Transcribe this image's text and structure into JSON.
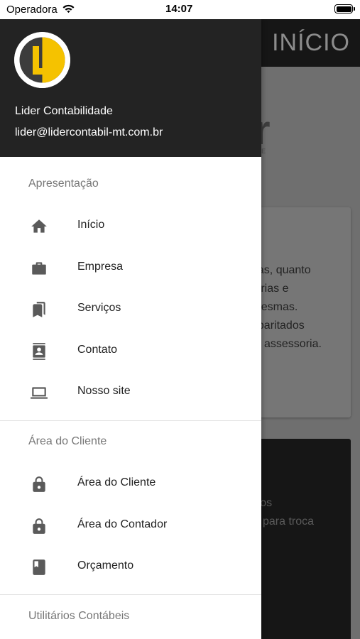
{
  "status_bar": {
    "carrier": "Operadora",
    "time": "14:07"
  },
  "background_screen": {
    "title": "INÍCIO",
    "logo_fragment": "r",
    "logo_sub_fragment": "E",
    "card_lines": [
      "esas, quanto",
      "torias e",
      "s mesmas.",
      "abaritados",
      "assessoria."
    ],
    "dark_card_lines": [
      "so aos",
      "para troca"
    ]
  },
  "drawer": {
    "header": {
      "name": "Lider Contabilidade",
      "email": "lider@lidercontabil-mt.com.br"
    },
    "sections": [
      {
        "title": "Apresentação",
        "items": [
          {
            "label": "Início",
            "icon": "home-icon"
          },
          {
            "label": "Empresa",
            "icon": "briefcase-icon"
          },
          {
            "label": "Serviços",
            "icon": "bookmarks-icon"
          },
          {
            "label": "Contato",
            "icon": "contact-card-icon"
          },
          {
            "label": "Nosso site",
            "icon": "laptop-icon"
          }
        ]
      },
      {
        "title": "Área do Cliente",
        "items": [
          {
            "label": "Área do Cliente",
            "icon": "lock-icon"
          },
          {
            "label": "Área do Contador",
            "icon": "lock-icon"
          },
          {
            "label": "Orçamento",
            "icon": "book-icon"
          }
        ]
      },
      {
        "title": "Utilitários Contábeis",
        "items": []
      }
    ]
  },
  "colors": {
    "header_bg": "#232323",
    "logo_yellow": "#f5c200",
    "icon_gray": "#5a5a5a"
  }
}
